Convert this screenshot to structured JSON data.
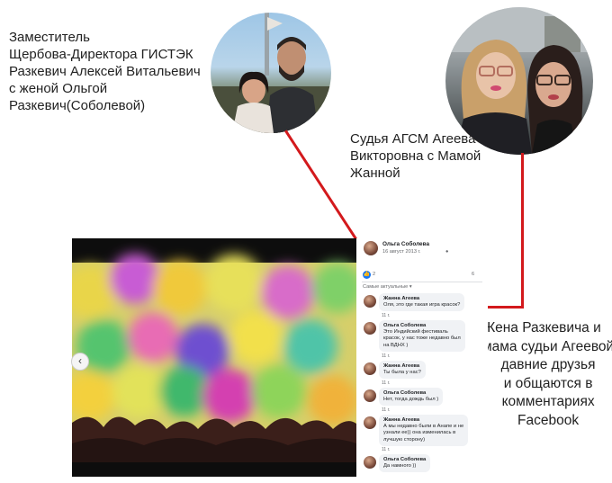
{
  "captions": {
    "left": [
      "Заместитель",
      "Щербова-Директора ГИСТЭК",
      "Разкевич Алексей Витальевич",
      "с женой Ольгой",
      "Разкевич(Соболевой)"
    ],
    "right": [
      "Судья АГСМ Агеева",
      "Викторовна с Мамой",
      "Жанной"
    ],
    "bottom": [
      "Жена Разкевича и",
      "мама судьи Агеевой",
      "давние друзья",
      "и общаются в",
      "комментариях",
      "Facebook"
    ]
  },
  "facebook_post": {
    "author": "Ольга Соболева",
    "date": "16 август 2013 г.",
    "likes": "2",
    "comments_count": "6",
    "sort_label": "Самые актуальные",
    "comments": [
      {
        "name": "Жанна Агеева",
        "text": "Оля, это где такая игра красок?",
        "age": "11 г."
      },
      {
        "name": "Ольга Соболева",
        "text": "Это Индийский фестиваль\nкрасок, у нас тоже недавно был\nна ВДНХ )",
        "age": "11 г."
      },
      {
        "name": "Жанна Агеева",
        "text": "Ты была у нас?",
        "age": "11 г."
      },
      {
        "name": "Ольга Соболева",
        "text": "Нет, тогда дождь был )",
        "age": "11 г."
      },
      {
        "name": "Жанна Агеева",
        "text": "А мы недавно были в Анапе и не\nузнали ее)) она изменилась в\nлучшую сторону)",
        "age": "11 г."
      },
      {
        "name": "Ольга Соболева",
        "text": "Да намного ))",
        "age": ""
      }
    ]
  },
  "colors": {
    "connector": "#d3191c",
    "fb_blue": "#1877f2",
    "bubble": "#f0f2f5"
  }
}
